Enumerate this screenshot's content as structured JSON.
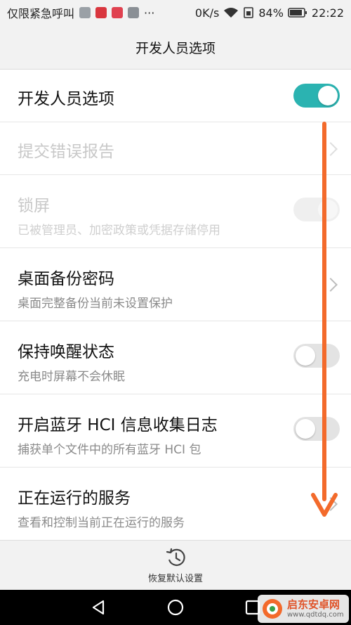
{
  "status_bar": {
    "carrier": "仅限紧急呼叫",
    "more": "···",
    "speed": "0K/s",
    "battery": "84%",
    "time": "22:22"
  },
  "app_bar": {
    "title": "开发人员选项"
  },
  "rows": [
    {
      "title": "开发人员选项",
      "toggle": "on"
    },
    {
      "title": "提交错误报告",
      "disabled": true
    },
    {
      "title": "锁屏",
      "subtitle": "已被管理员、加密政策或凭据存储停用",
      "disabled": true,
      "toggle": "on"
    },
    {
      "title": "桌面备份密码",
      "subtitle": "桌面完整备份当前未设置保护"
    },
    {
      "title": "保持唤醒状态",
      "subtitle": "充电时屏幕不会休眠",
      "toggle": "off"
    },
    {
      "title": "开启蓝牙 HCI 信息收集日志",
      "subtitle": "捕获单个文件中的所有蓝牙 HCI 包",
      "toggle": "off"
    },
    {
      "title": "正在运行的服务",
      "subtitle": "查看和控制当前正在运行的服务"
    }
  ],
  "footer": {
    "restore_label": "恢复默认设置"
  },
  "watermark": {
    "name": "启东安卓网",
    "url": "www.qdtdq.com"
  },
  "colors": {
    "accent": "#2bb3b1",
    "arrow": "#f36a2b"
  }
}
